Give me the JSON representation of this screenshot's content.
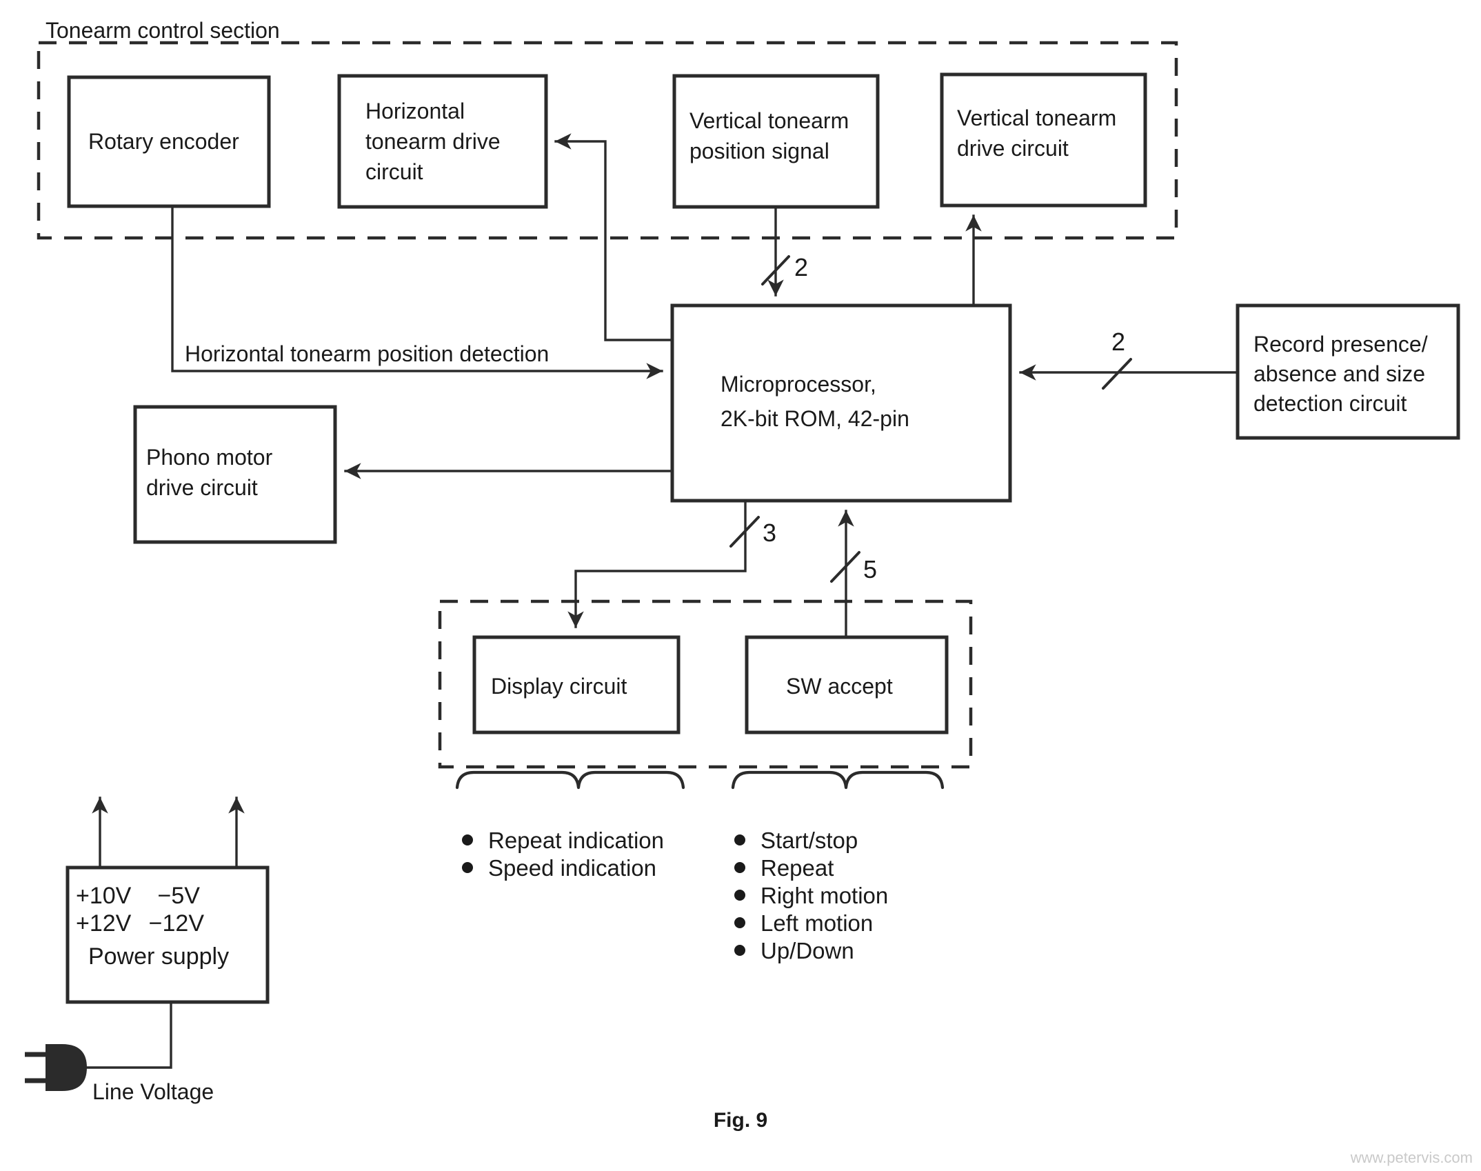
{
  "figure": {
    "caption": "Fig. 9",
    "watermark": "www.petervis.com"
  },
  "sections": {
    "tonearm_control": {
      "label": "Tonearm control section"
    },
    "control_panel": {
      "label": ""
    }
  },
  "blocks": {
    "rotary_encoder": {
      "label": "Rotary encoder"
    },
    "horizontal_drive": {
      "line1": "Horizontal",
      "line2": "tonearm drive",
      "line3": "circuit"
    },
    "vertical_position": {
      "line1": "Vertical tonearm",
      "line2": "position signal"
    },
    "vertical_drive": {
      "line1": "Vertical tonearm",
      "line2": "drive circuit"
    },
    "microprocessor": {
      "line1": "Microprocessor,",
      "line2": "2K-bit ROM, 42-pin"
    },
    "record_detection": {
      "line1": "Record presence/",
      "line2": "absence and size",
      "line3": "detection circuit"
    },
    "phono_motor": {
      "line1": "Phono motor",
      "line2": "drive circuit"
    },
    "display_circuit": {
      "label": "Display circuit"
    },
    "sw_accept": {
      "label": "SW accept"
    },
    "power_supply": {
      "label": "Power supply",
      "rail_pos_1": "+10V",
      "rail_pos_2": "+12V",
      "rail_neg_1": "−5V",
      "rail_neg_2": "−12V",
      "line_voltage_label": "Line Voltage"
    }
  },
  "wire_labels": {
    "horizontal_position_detection": "Horizontal tonearm position detection",
    "bus_vertical_position": "2",
    "bus_record_detection": "2",
    "bus_display": "3",
    "bus_sw_accept": "5"
  },
  "bullet_lists": {
    "display_functions": {
      "items": [
        "Repeat indication",
        "Speed indication"
      ]
    },
    "switch_functions": {
      "items": [
        "Start/stop",
        "Repeat",
        "Right motion",
        "Left motion",
        "Up/Down"
      ]
    }
  },
  "colors": {
    "ink": "#2b2b2b",
    "paper": "#ffffff",
    "watermark": "#c9c9c9"
  }
}
